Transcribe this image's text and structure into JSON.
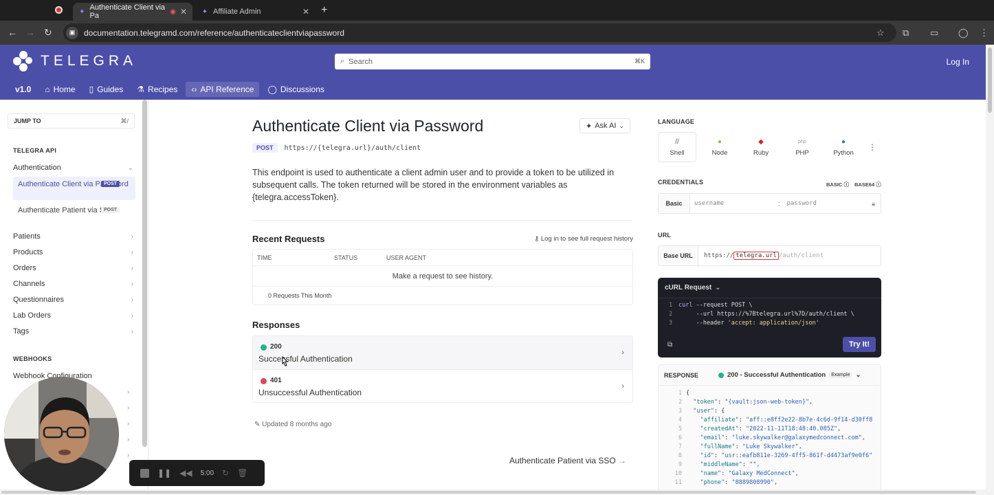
{
  "browser": {
    "tabs": [
      {
        "title": "Authenticate Client via Pa",
        "active": true
      },
      {
        "title": "Affiliate Admin",
        "active": false
      }
    ],
    "url": "documentation.telegramd.com/reference/authenticateclientviapassword"
  },
  "header": {
    "logo_text": "TELEGRA",
    "search_placeholder": "Search",
    "search_shortcut": "⌘K",
    "login": "Log In",
    "nav": [
      {
        "label": "v1.0",
        "icon": ""
      },
      {
        "label": "Home",
        "icon": "home-icon"
      },
      {
        "label": "Guides",
        "icon": "book-icon"
      },
      {
        "label": "Recipes",
        "icon": "flask-icon"
      },
      {
        "label": "API Reference",
        "icon": "code-icon",
        "active": true
      },
      {
        "label": "Discussions",
        "icon": "chat-icon"
      }
    ]
  },
  "sidebar": {
    "jump_to": "JUMP TO",
    "jump_shortcut": "⌘/",
    "section_api": "TELEGRA API",
    "group_auth": "Authentication",
    "auth_items": [
      {
        "label": "Authenticate Client via Password",
        "badge": "POST",
        "active": true
      },
      {
        "label": "Authenticate Patient via SSO",
        "badge": "POST",
        "active": false
      }
    ],
    "groups": [
      "Patients",
      "Products",
      "Orders",
      "Channels",
      "Questionnaires",
      "Lab Orders",
      "Tags"
    ],
    "section_webhooks": "WEBHOOKS",
    "webhook_items": [
      "Webhook Configuration"
    ]
  },
  "main": {
    "title": "Authenticate Client via Password",
    "ask_ai": "Ask AI",
    "method": "POST",
    "path": "https://{telegra.url}/auth/client",
    "description": "This endpoint is used to authenticate a client admin user and to provide a token to be utilized in subsequent calls. The token returned will be stored in the environment variables as {telegra.accessToken}.",
    "recent_requests": {
      "title": "Recent Requests",
      "login_hint": "Log in to see full request history",
      "columns": [
        "TIME",
        "STATUS",
        "USER AGENT"
      ],
      "empty": "Make a request to see history.",
      "count": "0 Requests This Month"
    },
    "responses_title": "Responses",
    "responses": [
      {
        "code": "200",
        "label": "Successful Authentication",
        "color": "#21b48a"
      },
      {
        "code": "401",
        "label": "Unsuccessful Authentication",
        "color": "#e0455a"
      }
    ],
    "updated": "Updated 8 months ago",
    "next_link": "Authenticate Patient via SSO"
  },
  "panel": {
    "language_label": "LANGUAGE",
    "languages": [
      {
        "name": "Shell",
        "icon": "//"
      },
      {
        "name": "Node",
        "icon": "●"
      },
      {
        "name": "Ruby",
        "icon": "◆"
      },
      {
        "name": "PHP",
        "icon": "php"
      },
      {
        "name": "Python",
        "icon": "●"
      }
    ],
    "credentials_label": "CREDENTIALS",
    "basic_opt": "BASIC",
    "base64_opt": "BASE64",
    "auth_type": "Basic",
    "username_placeholder": "username",
    "separator": ":",
    "password_placeholder": "password",
    "url_label": "URL",
    "base_url_label": "Base URL",
    "base_url_prefix": "https://",
    "base_url_var": "telegra.url",
    "base_url_suffix": "/auth/client",
    "curl_title": "cURL Request",
    "curl_lines": [
      {
        "n": "1",
        "kw": "curl",
        "rest": " --request POST \\"
      },
      {
        "n": "2",
        "kw": "",
        "rest": "     --url https://%7Btelegra.url%7D/auth/client \\"
      },
      {
        "n": "3",
        "kw": "",
        "rest": "     --header ",
        "str": "'accept: application/json'"
      }
    ],
    "try_it": "Try It!",
    "response_label": "RESPONSE",
    "response_status": "200 - Successful Authentication",
    "response_example": "Example",
    "json_lines": [
      {
        "n": "1",
        "text": "{"
      },
      {
        "n": "2",
        "key": "  \"token\"",
        "val": "\"{vault:json-web-token}\","
      },
      {
        "n": "3",
        "key": "  \"user\"",
        "val": "{"
      },
      {
        "n": "4",
        "key": "    \"affiliate\"",
        "val": "\"aff::e8ff2e22-8b7e-4c6d-9f14-d30ff8"
      },
      {
        "n": "5",
        "key": "    \"createdAt\"",
        "val": "\"2022-11-11T18:48:40.085Z\","
      },
      {
        "n": "6",
        "key": "    \"email\"",
        "val": "\"luke.skywalker@galaxymedconnect.com\","
      },
      {
        "n": "7",
        "key": "    \"fullName\"",
        "val": "\"Luke Skywalker\","
      },
      {
        "n": "8",
        "key": "    \"id\"",
        "val": "\"usr::eafb811e-3269-4ff5-861f-d4473af9e0f6\""
      },
      {
        "n": "9",
        "key": "    \"middleName\"",
        "val": "\"\","
      },
      {
        "n": "10",
        "key": "    \"name\"",
        "val": "\"Galaxy MedConnect\","
      },
      {
        "n": "11",
        "key": "    \"phone\"",
        "val": "\"8889808990\","
      }
    ]
  },
  "recorder": {
    "time": "5:00"
  }
}
